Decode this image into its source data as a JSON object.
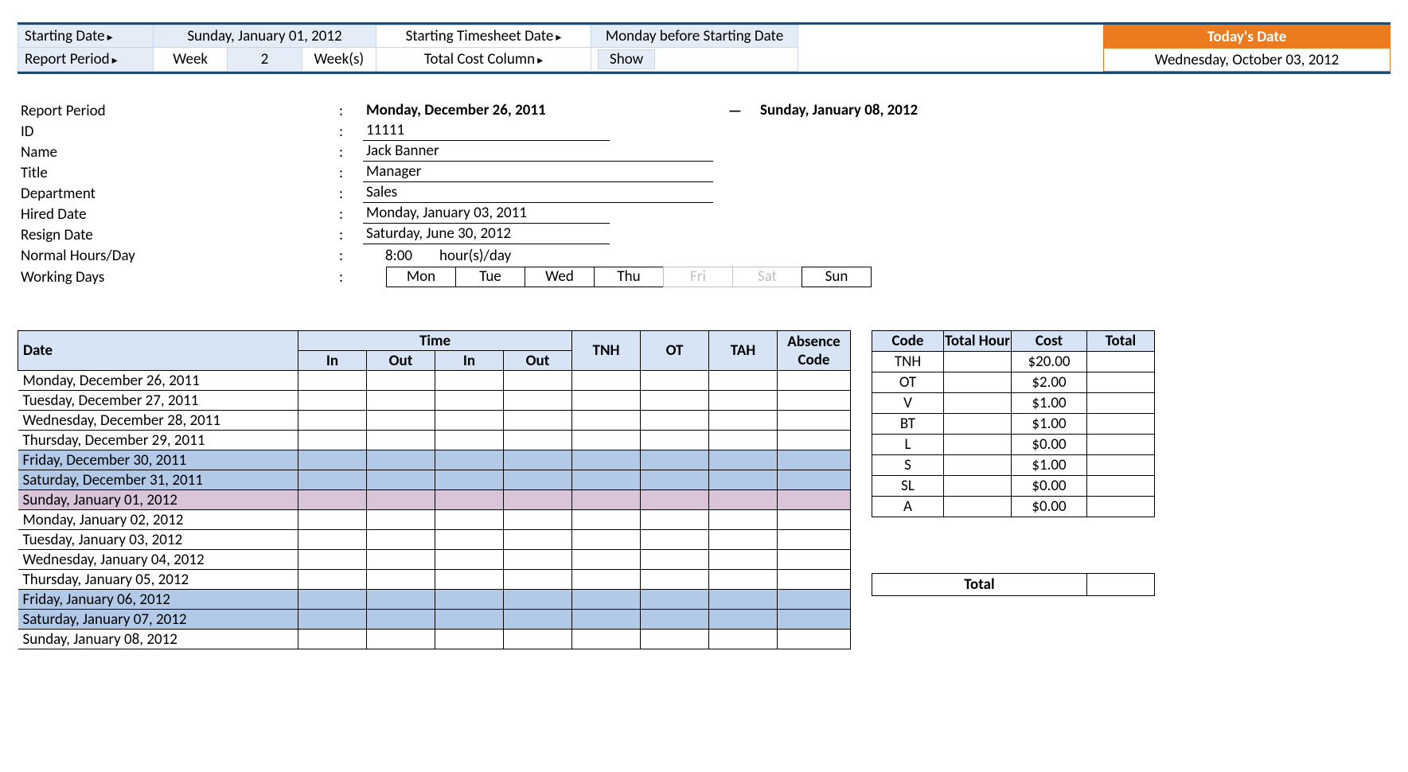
{
  "top": {
    "starting_date_label": "Starting Date",
    "starting_date_value": "Sunday, January 01, 2012",
    "starting_ts_label": "Starting Timesheet Date",
    "starting_ts_value": "Monday before Starting Date",
    "report_period_label": "Report Period",
    "report_unit": "Week",
    "report_count": "2",
    "report_suffix": "Week(s)",
    "cost_col_label": "Total Cost Column",
    "cost_col_value": "Show",
    "today_label": "Today's Date",
    "today_value": "Wednesday, October 03, 2012"
  },
  "info": {
    "report_period_lbl": "Report Period",
    "report_start": "Monday, December 26, 2011",
    "report_dash": "—",
    "report_end": "Sunday, January 08, 2012",
    "id_lbl": "ID",
    "id_val": "11111",
    "name_lbl": "Name",
    "name_val": "Jack Banner",
    "title_lbl": "Title",
    "title_val": "Manager",
    "dept_lbl": "Department",
    "dept_val": "Sales",
    "hired_lbl": "Hired Date",
    "hired_val": "Monday, January 03, 2011",
    "resign_lbl": "Resign Date",
    "resign_val": "Saturday, June 30, 2012",
    "nh_lbl": "Normal Hours/Day",
    "nh_hours": "8:00",
    "nh_unit": "hour(s)/day",
    "wd_lbl": "Working Days",
    "days": [
      "Mon",
      "Tue",
      "Wed",
      "Thu",
      "Fri",
      "Sat",
      "Sun"
    ]
  },
  "ts": {
    "hdr_date": "Date",
    "hdr_time": "Time",
    "hdr_in": "In",
    "hdr_out": "Out",
    "hdr_tnh": "TNH",
    "hdr_ot": "OT",
    "hdr_tah": "TAH",
    "hdr_abs": "Absence Code",
    "rows": [
      {
        "d": "Monday, December 26, 2011",
        "c": ""
      },
      {
        "d": "Tuesday, December 27, 2011",
        "c": ""
      },
      {
        "d": "Wednesday, December 28, 2011",
        "c": ""
      },
      {
        "d": "Thursday, December 29, 2011",
        "c": ""
      },
      {
        "d": "Friday, December 30, 2011",
        "c": "rfri"
      },
      {
        "d": "Saturday, December 31, 2011",
        "c": "rsat"
      },
      {
        "d": "Sunday, January 01, 2012",
        "c": "rsun"
      },
      {
        "d": "Monday, January 02, 2012",
        "c": ""
      },
      {
        "d": "Tuesday, January 03, 2012",
        "c": ""
      },
      {
        "d": "Wednesday, January 04, 2012",
        "c": ""
      },
      {
        "d": "Thursday, January 05, 2012",
        "c": ""
      },
      {
        "d": "Friday, January 06, 2012",
        "c": "rfri"
      },
      {
        "d": "Saturday, January 07, 2012",
        "c": "rsat"
      },
      {
        "d": "Sunday, January 08, 2012",
        "c": ""
      }
    ]
  },
  "codes": {
    "h1": "Code",
    "h2": "Total Hour",
    "h3": "Cost",
    "h4": "Total",
    "rows": [
      {
        "code": "TNH",
        "cost": "$20.00"
      },
      {
        "code": "OT",
        "cost": "$2.00"
      },
      {
        "code": "V",
        "cost": "$1.00"
      },
      {
        "code": "BT",
        "cost": "$1.00"
      },
      {
        "code": "L",
        "cost": "$0.00"
      },
      {
        "code": "S",
        "cost": "$1.00"
      },
      {
        "code": "SL",
        "cost": "$0.00"
      },
      {
        "code": "A",
        "cost": "$0.00"
      }
    ]
  },
  "total_label": "Total"
}
